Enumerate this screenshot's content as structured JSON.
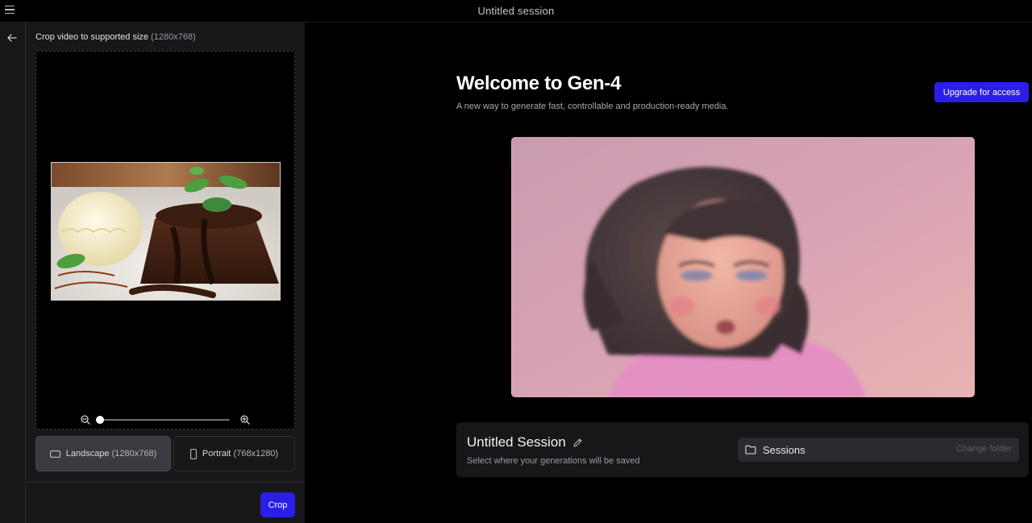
{
  "topbar": {
    "session_title": "Untitled session"
  },
  "crop_panel": {
    "header_label": "Crop video to supported size",
    "header_size": "(1280x768)",
    "zoom_level": 0,
    "landscape": {
      "label": "Landscape",
      "size": "(1280x768)"
    },
    "portrait": {
      "label": "Portrait",
      "size": "(768x1280)"
    },
    "crop_label": "Crop"
  },
  "main": {
    "title": "Welcome to Gen-4",
    "subtitle": "A new way to generate fast, controllable and production-ready media.",
    "upgrade_label": "Upgrade for access"
  },
  "session_card": {
    "name": "Untitled Session",
    "hint": "Select where your generations will be saved",
    "folder_label": "Sessions",
    "change_folder_label": "Change folder"
  },
  "colors": {
    "accent": "#2b1ee8",
    "panel": "#17171a",
    "background": "#000000"
  },
  "icons": [
    "menu-icon",
    "arrow-left-icon",
    "zoom-out-icon",
    "zoom-in-icon",
    "landscape-icon",
    "portrait-icon",
    "pencil-icon",
    "folder-icon"
  ]
}
